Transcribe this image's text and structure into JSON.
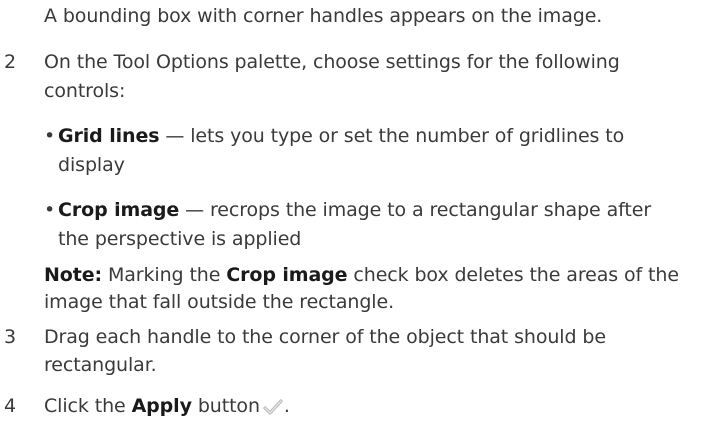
{
  "intro_text": "A bounding box with corner handles appears on the image.",
  "steps": [
    {
      "number": "2",
      "line1": "On the Tool Options palette, choose settings for the following",
      "line2": "controls:"
    },
    {
      "number": "3",
      "line1": "Drag each handle to the corner of the object that should be",
      "line2": "rectangular."
    },
    {
      "number": "4",
      "prefix": "Click the",
      "bold": "Apply",
      "suffix": "button",
      "end": "."
    }
  ],
  "bullets": [
    {
      "term": "Grid lines",
      "line1_rest": " — lets you type or set the number of gridlines to",
      "line2": "display"
    },
    {
      "term": "Crop image",
      "line1_rest": " — recrops the image to a rectangular shape after",
      "line2": "the perspective is applied"
    }
  ],
  "note": {
    "label": "Note:",
    "text_a": "  Marking the ",
    "term": "Crop image",
    "text_b": " check box deletes the areas of the",
    "line2": "image that fall outside the rectangle."
  },
  "icons": {
    "apply": "checkmark-icon"
  }
}
